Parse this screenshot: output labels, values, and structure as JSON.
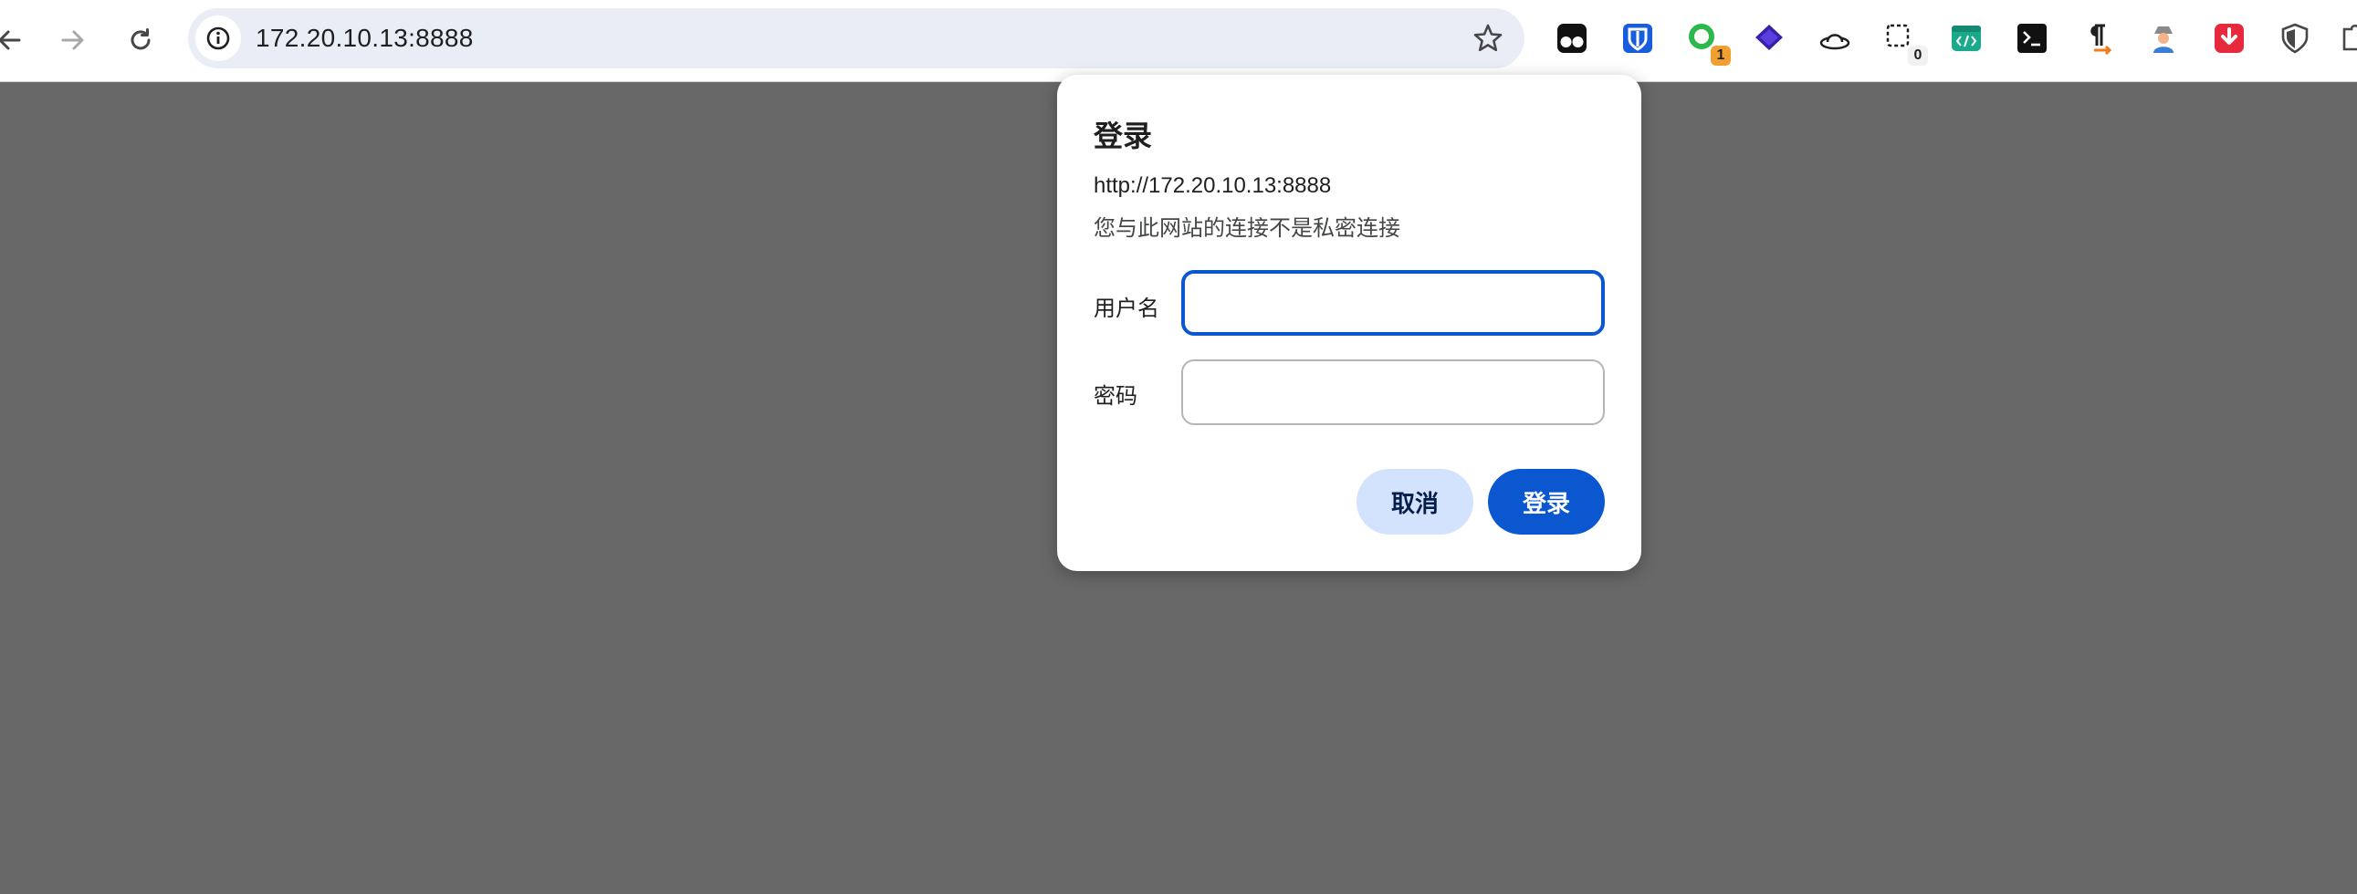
{
  "browser": {
    "url": "172.20.10.13:8888",
    "extensions": [
      {
        "name": "tampermonkey",
        "badge": ""
      },
      {
        "name": "bitwarden",
        "badge": ""
      },
      {
        "name": "green-circle",
        "badge": "1"
      },
      {
        "name": "purple-stack",
        "badge": ""
      },
      {
        "name": "hat",
        "badge": ""
      },
      {
        "name": "counter",
        "badge": "0"
      },
      {
        "name": "code-window",
        "badge": ""
      },
      {
        "name": "terminal",
        "badge": ""
      },
      {
        "name": "pilcrow",
        "badge": ""
      },
      {
        "name": "spy",
        "badge": ""
      },
      {
        "name": "download-red",
        "badge": ""
      },
      {
        "name": "shield",
        "badge": ""
      }
    ]
  },
  "dialog": {
    "title": "登录",
    "origin": "http://172.20.10.13:8888",
    "warning": "您与此网站的连接不是私密连接",
    "username_label": "用户名",
    "username_value": "",
    "password_label": "密码",
    "password_value": "",
    "cancel_label": "取消",
    "login_label": "登录"
  },
  "colors": {
    "page_overlay": "#686868",
    "omnibox": "#e9eef6",
    "primary": "#0b57d0",
    "cancel_bg": "#d3e3fd"
  }
}
